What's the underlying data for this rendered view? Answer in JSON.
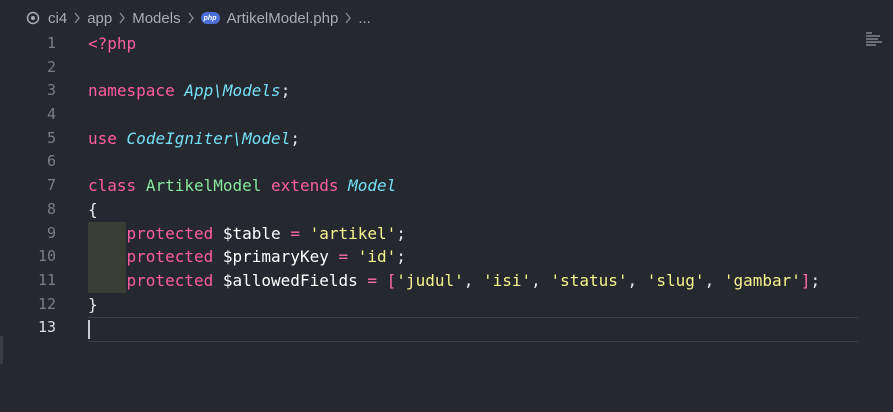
{
  "breadcrumb": {
    "items": [
      "ci4",
      "app",
      "Models",
      "ArtikelModel.php",
      "..."
    ],
    "file_badge": "php"
  },
  "line_numbers": [
    "1",
    "2",
    "3",
    "4",
    "5",
    "6",
    "7",
    "8",
    "9",
    "10",
    "11",
    "12",
    "13"
  ],
  "code": {
    "l1": "<?php",
    "l3_kw": "namespace",
    "l3_ns1": "App",
    "l3_sep": "\\",
    "l3_ns2": "Models",
    "l3_end": ";",
    "l5_kw": "use",
    "l5_ns1": "CodeIgniter",
    "l5_sep": "\\",
    "l5_ns2": "Model",
    "l5_end": ";",
    "l7_kw": "class",
    "l7_name": "ArtikelModel",
    "l7_ext": "extends",
    "l7_parent": "Model",
    "l8": "{",
    "l9_kw": "protected",
    "l9_var": "$table",
    "l9_op": "=",
    "l9_str": "'artikel'",
    "l9_end": ";",
    "l10_kw": "protected",
    "l10_var": "$primaryKey",
    "l10_op": "=",
    "l10_str": "'id'",
    "l10_end": ";",
    "l11_kw": "protected",
    "l11_var": "$allowedFields",
    "l11_op": "=",
    "l11_open": "[",
    "l11_s1": "'judul'",
    "l11_s2": "'isi'",
    "l11_s3": "'status'",
    "l11_s4": "'slug'",
    "l11_s5": "'gambar'",
    "l11_close": "]",
    "l11_end": ";",
    "l12": "}"
  },
  "colors": {
    "background": "#262830",
    "keyword": "#ff5ca1",
    "type": "#74e0f5",
    "class_name": "#85e89d",
    "string": "#f6f48c"
  }
}
